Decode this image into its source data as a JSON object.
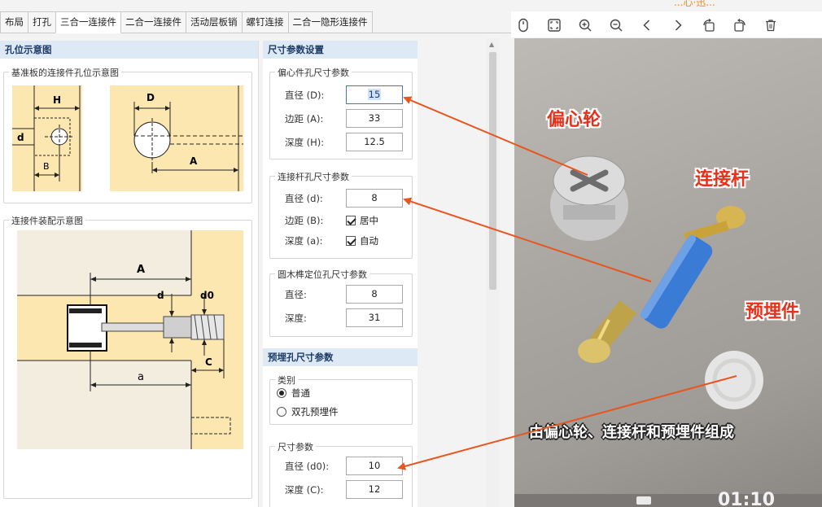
{
  "tabs": [
    "布局",
    "打孔",
    "三合一连接件",
    "二合一连接件",
    "活动层板销",
    "螺钉连接",
    "二合一隐形连接件"
  ],
  "active_tab": "三合一连接件",
  "left": {
    "header": "孔位示意图",
    "group1_title": "基准板的连接件孔位示意图",
    "group2_title": "连接件装配示意图",
    "diagram1_labels": {
      "H": "H",
      "d": "d",
      "B": "B",
      "D": "D",
      "A": "A"
    },
    "diagram2_labels": {
      "A": "A",
      "d": "d",
      "d0": "d0",
      "C": "C",
      "a": "a"
    }
  },
  "right": {
    "header": "尺寸参数设置",
    "eccentric": {
      "title": "偏心件孔尺寸参数",
      "rows": [
        {
          "label": "直径 (D):",
          "value": "15"
        },
        {
          "label": "边距 (A):",
          "value": "33"
        },
        {
          "label": "深度 (H):",
          "value": "12.5"
        }
      ]
    },
    "rod": {
      "title": "连接杆孔尺寸参数",
      "diameter_label": "直径 (d):",
      "diameter_value": "8",
      "margin_label": "边距 (B):",
      "margin_check": "居中",
      "depth_label": "深度 (a):",
      "depth_check": "自动"
    },
    "dowel": {
      "title": "圆木榫定位孔尺寸参数",
      "rows": [
        {
          "label": "直径:",
          "value": "8"
        },
        {
          "label": "深度:",
          "value": "31"
        }
      ]
    },
    "embed_header": "预埋孔尺寸参数",
    "category": {
      "title": "类别",
      "options": [
        "普通",
        "双孔预埋件"
      ],
      "selected": "普通"
    },
    "size": {
      "title": "尺寸参数",
      "rows": [
        {
          "label": "直径 (d0):",
          "value": "10"
        },
        {
          "label": "深度 (C):",
          "value": "12"
        }
      ]
    }
  },
  "viewer": {
    "toolbar_icons": [
      "mouse-icon",
      "fullscreen-icon",
      "zoom-in-icon",
      "zoom-out-icon",
      "previous-icon",
      "next-icon",
      "rotate-left-icon",
      "rotate-right-icon",
      "delete-icon"
    ],
    "labels": {
      "eccentric": "偏心轮",
      "rod": "连接杆",
      "embed": "预埋件"
    },
    "caption": "由偏心轮、连接杆和预埋件组成",
    "timecode": "01:10",
    "top_text": "...心·迅..."
  },
  "colors": {
    "arrow": "#e8551f",
    "label_red": "#e8301b",
    "header_bg": "#dde9f5",
    "diagram_bg": "#fde7b0",
    "dowel_blue": "#3a7bd5"
  }
}
